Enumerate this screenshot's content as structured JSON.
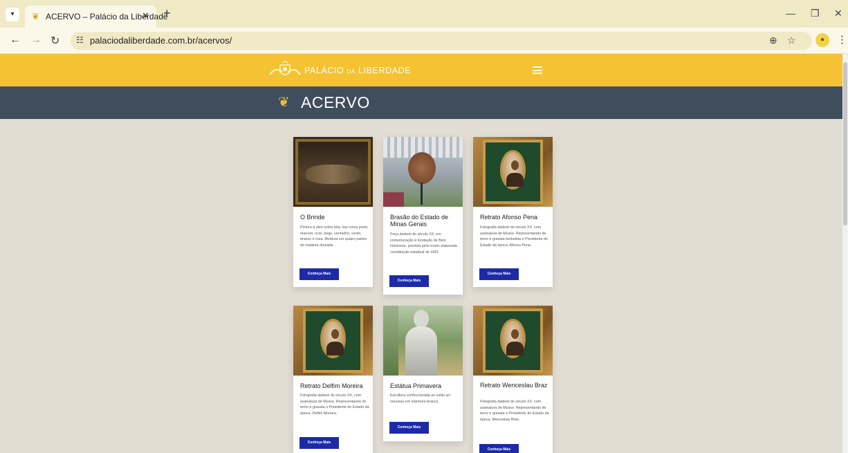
{
  "browser": {
    "tab_title": "ACERVO – Palácio da Liberdade",
    "url": "palaciodaliberdade.com.br/acervos/"
  },
  "site": {
    "logo_text_1": "PALÁCIO",
    "logo_text_small": "DA",
    "logo_text_2": "LIBERDADE",
    "page_title": "ACERVO"
  },
  "cards": [
    {
      "title": "O Brinde",
      "description": "Pintura à óleo sobre tela, nas cores preto, marrom, ocre, bege, vermelho, verde, branco e rosa. Moldura em quatro partes de madeira dourada.",
      "button": "Conheça Mais"
    },
    {
      "title": "Brasão do Estado de Minas Gerais",
      "description": "Peça datável do século XX, em comemoração à fundação de Belo Horizonte, prevista pela recém elaborada constituição estadual de 1891.",
      "button": "Conheça Mais"
    },
    {
      "title": "Retrato Afonso Pena",
      "description": "Fotografia datável do século XX, com assinatura de Musso. Representando de terno e gravata borboleta o Presidente do Estado da época, Afonso Pena.",
      "button": "Conheça Mais"
    },
    {
      "title": "Retrato Delfim Moreira",
      "description": "Fotografia datável do século XX, com assinatura de Musso. Representando de terno e gravata o Presidente do Estado da época, Delfim Moreira.",
      "button": "Conheça Mais"
    },
    {
      "title": "Estátua Primavera",
      "description": "Escultura confeccionada ao estilo art-nouveau em mármore branco.",
      "button": "Conheça Mais"
    },
    {
      "title": "Retrato Wenceslau Braz",
      "description": "Fotografia datável do século XX, com assinatura de Musso. Representando de terno e gravata o Presidente do Estado da época, Wenceslau Brás.",
      "button": "Conheça Mais"
    }
  ],
  "colors": {
    "header_yellow": "#f4c232",
    "title_band": "#3f4d5c",
    "page_bg": "#e2ddd3",
    "button_blue": "#1c2aa8"
  }
}
